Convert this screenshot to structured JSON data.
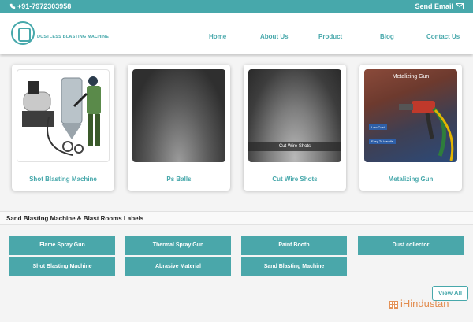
{
  "topbar": {
    "phone": "+91-7972303958",
    "email_label": "Send Email"
  },
  "header": {
    "logo_text": "DUSTLESS BLASTING MACHINE",
    "nav": [
      "Home",
      "About Us",
      "Product",
      "Blog",
      "Contact Us"
    ]
  },
  "products": [
    {
      "label": "Shot Blasting Machine"
    },
    {
      "label": "Ps Balls"
    },
    {
      "label": "Cut Wire Shots",
      "image_caption": "Cut Wire Shots"
    },
    {
      "label": "Metalizing Gun",
      "image_caption": "Metalizing Gun",
      "image_tags": [
        "Low Cost",
        "Easy To Handle"
      ]
    }
  ],
  "section": {
    "title": "Sand Blasting Machine & Blast Rooms Labels",
    "tags": [
      "Flame Spray Gun",
      "Thermal Spray Gun",
      "Paint Booth",
      "Dust collector",
      "Shot Blasting Machine",
      "Abrasive Material",
      "Sand Blasting Machine"
    ],
    "view_all": "View All"
  },
  "watermark": "iHindustan",
  "colors": {
    "accent": "#47a8ab",
    "button": "#4aa7aa",
    "watermark": "#e07a32"
  }
}
